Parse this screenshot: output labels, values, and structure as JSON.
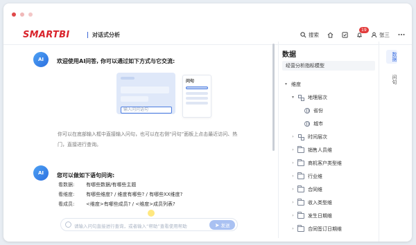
{
  "window": {
    "dot_colors": [
      "#e0484a",
      "#f0b8b8",
      "#f3c7c7"
    ]
  },
  "header": {
    "logo": "SMARTBI",
    "page_title": "对话式分析",
    "search_label": "搜索",
    "notification_count": "19",
    "user_name": "张三",
    "brand_color": "#d9232b",
    "accent_color": "#3a6ee0"
  },
  "chat": {
    "welcome_title": "欢迎使用AI问答, 你可以通过如下方式与它交流:",
    "avatar_label": "AI",
    "illustration": {
      "panel_title": "问句",
      "input_placeholder": "输入问问语句"
    },
    "hint_line1": "你可以在底部输入框中直接输入问句，也可以在右侧“问句”面板上点击最近访问、热",
    "hint_line2": "门，直接进行查询。",
    "questions_title": "您可以做如下语句问询:",
    "questions": [
      {
        "key": "看数据:",
        "value": "有哪些数据/有哪些主题"
      },
      {
        "key": "看维度:",
        "value": "有哪些维度? / 维度有哪些? / 有哪些XX维度?"
      },
      {
        "key": "看成员:",
        "value": "<维度>有哪些成员? / <维度>成员列表?"
      }
    ],
    "input_placeholder": "请输入问句直接进行查询，或者输入“帮助”查看使用帮助",
    "send_label": "发送"
  },
  "panel": {
    "title": "数据",
    "model_name": "经营分析指标模型",
    "tree": [
      {
        "label": "维度",
        "level": 0,
        "caret": "▾",
        "icon": "none"
      },
      {
        "label": "地理层次",
        "level": 1,
        "caret": "▾",
        "icon": "hierarchy-icon"
      },
      {
        "label": "省份",
        "level": 2,
        "caret": "",
        "icon": "globe-icon"
      },
      {
        "label": "城市",
        "level": 2,
        "caret": "",
        "icon": "globe-icon"
      },
      {
        "label": "时间层次",
        "level": 1,
        "caret": "›",
        "icon": "hierarchy-icon"
      },
      {
        "label": "销售人员维",
        "level": 1,
        "caret": "›",
        "icon": "folder-icon"
      },
      {
        "label": "商机客户类型维",
        "level": 1,
        "caret": "›",
        "icon": "folder-icon"
      },
      {
        "label": "行业维",
        "level": 1,
        "caret": "›",
        "icon": "folder-icon"
      },
      {
        "label": "合同维",
        "level": 1,
        "caret": "›",
        "icon": "folder-icon"
      },
      {
        "label": "收入类型维",
        "level": 1,
        "caret": "›",
        "icon": "folder-icon"
      },
      {
        "label": "发生日期维",
        "level": 1,
        "caret": "›",
        "icon": "folder-icon"
      },
      {
        "label": "合同签订日期维",
        "level": 1,
        "caret": "›",
        "icon": "folder-icon"
      }
    ]
  },
  "side_tabs": [
    {
      "label": "数据",
      "active": true
    },
    {
      "label": "问句",
      "active": false
    }
  ]
}
